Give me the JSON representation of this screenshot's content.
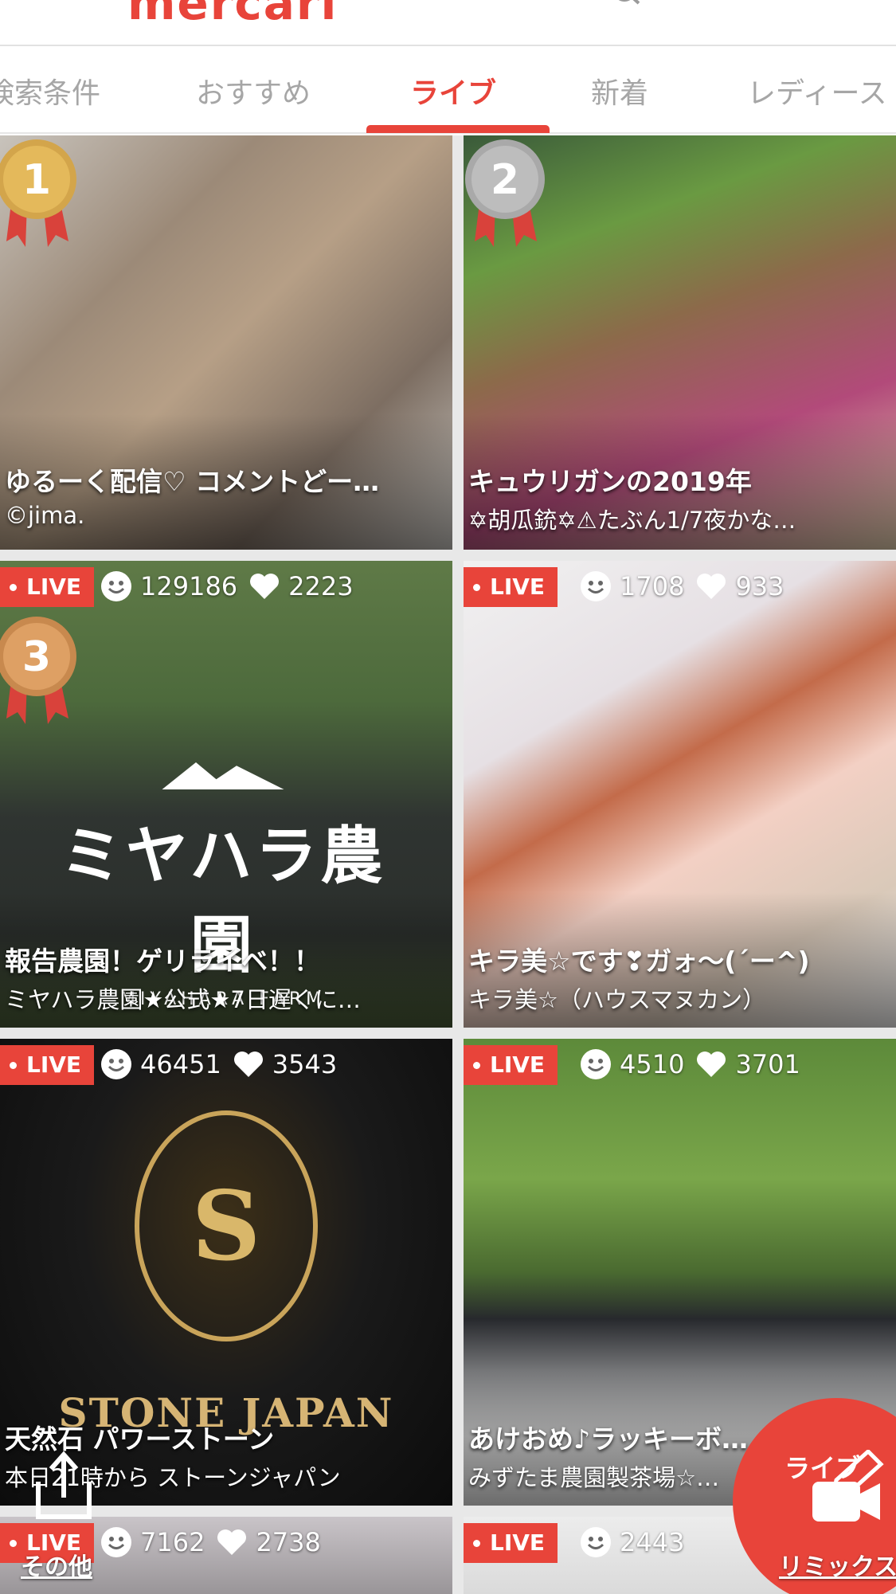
{
  "header": {
    "logo": "mercari",
    "icons": [
      "menu-icon",
      "search-icon",
      "bell-icon",
      "check-icon"
    ]
  },
  "tabs": [
    {
      "label": "検索条件"
    },
    {
      "label": "おすすめ"
    },
    {
      "label": "ライブ",
      "active": true
    },
    {
      "label": "新着"
    },
    {
      "label": "レディース"
    }
  ],
  "colors": {
    "accent": "#e8443a",
    "tab_inactive": "#a6a6a6"
  },
  "cards": [
    {
      "rank": "1",
      "title": "ゆるーく配信♡ コメントどー…",
      "subtitle": "©jima.",
      "live": false
    },
    {
      "rank": "2",
      "title": "キュウリガンの2019年",
      "subtitle": "✡胡瓜銃✡⚠たぶん1/7夜かな…",
      "live": false
    },
    {
      "rank": "3",
      "live_label": "LIVE",
      "viewers": "129186",
      "likes": "2223",
      "overlay_logo": "ミヤハラ農園",
      "overlay_logo_sub": "MIYAHARA FARM",
      "title": "報告農園！ゲリライベ！！",
      "subtitle": "ミヤハラ農園★公式★7日遅くに…"
    },
    {
      "live_label": "LIVE",
      "viewers": "1708",
      "likes": "933",
      "title": "キラ美☆です❣ガォ〜(´ー^)",
      "subtitle": "キラ美☆（ハウスマヌカン）"
    },
    {
      "live_label": "LIVE",
      "viewers": "46451",
      "likes": "3543",
      "overlay_logo": "S",
      "overlay_logo_sub": "STONE JAPAN",
      "title": "天然石 パワーストーン",
      "subtitle": "本日21時から ストーンジャパン"
    },
    {
      "live_label": "LIVE",
      "viewers": "4510",
      "likes": "3701",
      "title": "あけおめ♪ラッキーボ…",
      "subtitle": "みずたま農園製茶場☆…"
    },
    {
      "live_label": "LIVE",
      "viewers": "7162",
      "likes": "2738"
    },
    {
      "live_label": "LIVE",
      "viewers": "2443"
    }
  ],
  "floating": {
    "share_label": "その他",
    "live_start_label": "ライブ",
    "remix_label": "リミックス"
  }
}
